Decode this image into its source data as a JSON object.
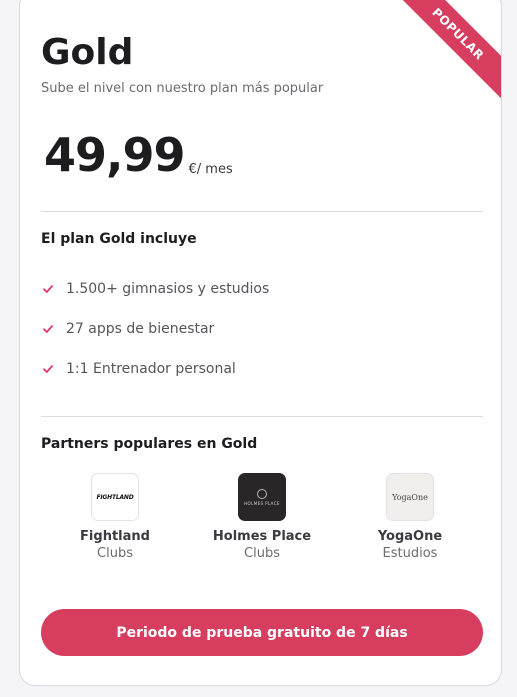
{
  "badge": "POPULAR",
  "plan": {
    "name": "Gold",
    "subtitle": "Sube el nivel con nuestro plan más popular",
    "price": "49,99",
    "price_unit": "€/ mes"
  },
  "includes": {
    "heading": "El plan Gold incluye",
    "items": [
      "1.500+ gimnasios y estudios",
      "27 apps de bienestar",
      "1:1 Entrenador personal"
    ]
  },
  "partners": {
    "heading": "Partners populares en Gold",
    "items": [
      {
        "name": "Fightland",
        "type": "Clubs",
        "logo_text": "FIGHTLAND"
      },
      {
        "name": "Holmes Place",
        "type": "Clubs",
        "logo_text": "HOLMES PLACE"
      },
      {
        "name": "YogaOne",
        "type": "Estudios",
        "logo_text": "YogaOne"
      }
    ]
  },
  "cta": {
    "label": "Periodo de prueba gratuito de 7 días"
  },
  "colors": {
    "accent": "#d63d5e",
    "text_dark": "#1d1d1f",
    "text_muted": "#6b6b72"
  },
  "icons": {
    "feature_bullet": "check-icon"
  }
}
